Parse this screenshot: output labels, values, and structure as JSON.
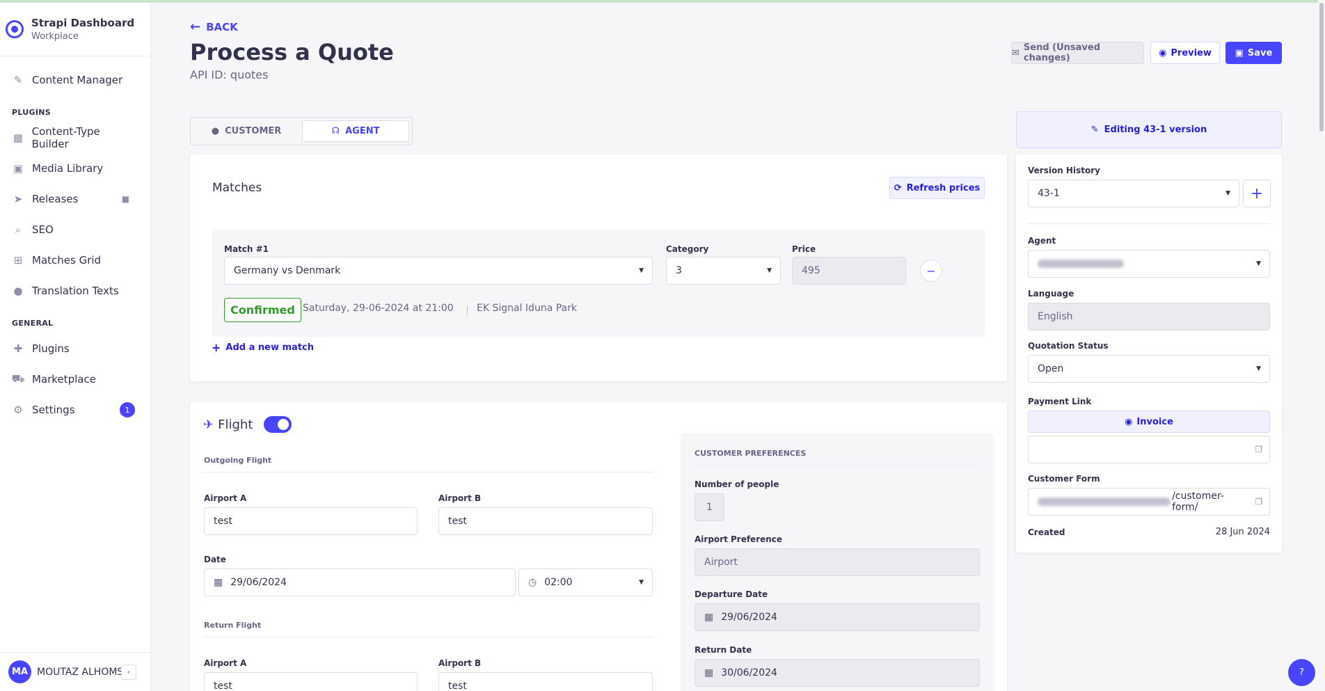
{
  "sidebar": {
    "brand_title": "Strapi Dashboard",
    "brand_sub": "Workplace",
    "content_manager": "Content Manager",
    "plugins_heading": "PLUGINS",
    "plugins": [
      "Content-Type Builder",
      "Media Library",
      "Releases",
      "SEO",
      "Matches Grid",
      "Translation Texts"
    ],
    "general_heading": "GENERAL",
    "general": [
      "Plugins",
      "Marketplace",
      "Settings"
    ],
    "settings_badge": "1",
    "user_initials": "MA",
    "user_name": "MOUTAZ ALHOMSI"
  },
  "header": {
    "back": "BACK",
    "title": "Process a Quote",
    "api_id": "API ID: quotes",
    "send_label": "Send (Unsaved changes)",
    "preview_label": "Preview",
    "save_label": "Save"
  },
  "tabs": {
    "customer": "CUSTOMER",
    "agent": "AGENT"
  },
  "matches": {
    "title": "Matches",
    "refresh_label": "Refresh prices",
    "match_label": "Match #1",
    "match_value": "Germany vs Denmark",
    "category_label": "Category",
    "category_value": "3",
    "price_label": "Price",
    "price_value": "495",
    "status": "Confirmed",
    "datetime": "Saturday, 29-06-2024 at 21:00",
    "venue": "EK Signal Iduna Park",
    "add_match": "Add a new match"
  },
  "flight": {
    "title": "Flight",
    "outgoing_heading": "Outgoing Flight",
    "airport_a_label": "Airport A",
    "airport_a_value": "test",
    "airport_b_label": "Airport B",
    "airport_b_value": "test",
    "date_label": "Date",
    "date_value": "29/06/2024",
    "time_value": "02:00",
    "return_heading": "Return Flight",
    "ret_airport_a_label": "Airport A",
    "ret_airport_a_value": "test",
    "ret_airport_b_label": "Airport B",
    "ret_airport_b_value": "test"
  },
  "preferences": {
    "heading": "CUSTOMER PREFERENCES",
    "people_label": "Number of people",
    "people_value": "1",
    "airport_pref_label": "Airport Preference",
    "airport_pref_placeholder": "Airport",
    "departure_label": "Departure Date",
    "departure_value": "29/06/2024",
    "return_label": "Return Date",
    "return_value": "30/06/2024"
  },
  "side": {
    "editing": "Editing 43-1 version",
    "version_history_label": "Version History",
    "version_value": "43-1",
    "agent_label": "Agent",
    "language_label": "Language",
    "language_value": "English",
    "quotation_status_label": "Quotation Status",
    "quotation_status_value": "Open",
    "payment_link_label": "Payment Link",
    "invoice_label": "Invoice",
    "customer_form_label": "Customer Form",
    "customer_form_suffix": "/customer-form/",
    "created_label": "Created",
    "created_value": "28 Jun 2024"
  },
  "help_label": "?"
}
